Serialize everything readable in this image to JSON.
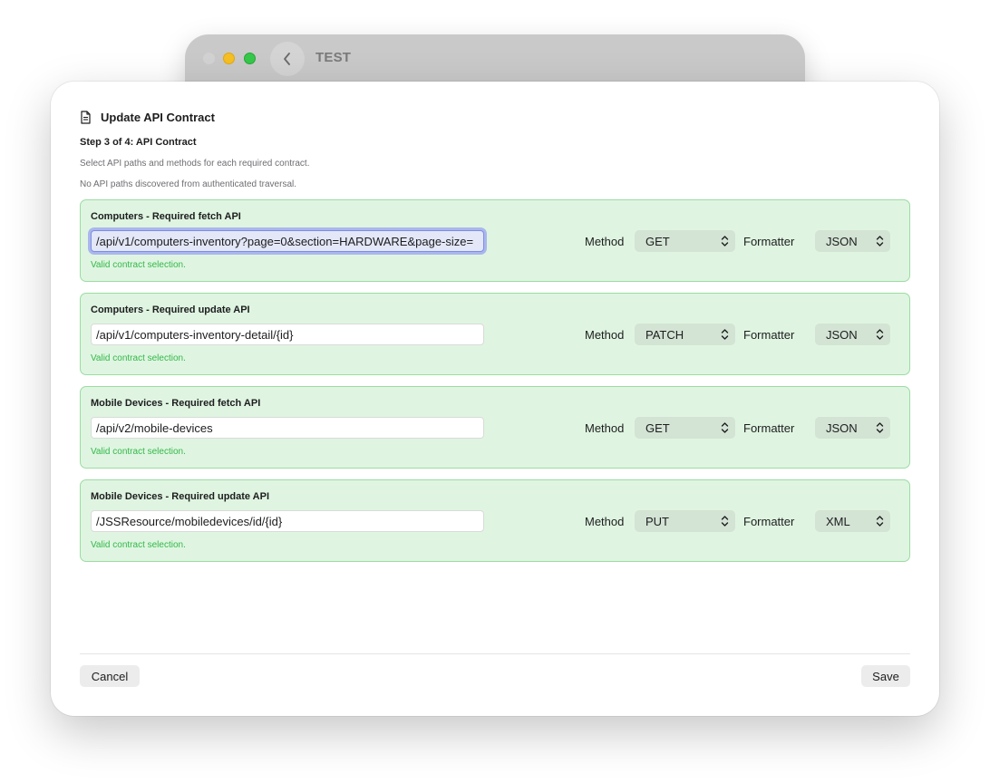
{
  "background_window": {
    "title": "TEST"
  },
  "sheet": {
    "title": "Update API Contract",
    "step": "Step 3 of 4: API Contract",
    "hint": "Select API paths and methods for each required contract.",
    "notice": "No API paths discovered from authenticated traversal."
  },
  "labels": {
    "method": "Method",
    "formatter": "Formatter"
  },
  "contracts": [
    {
      "title": "Computers - Required fetch API",
      "path": "/api/v1/computers-inventory?page=0&section=HARDWARE&page-size=",
      "method": "GET",
      "formatter": "JSON",
      "status": "Valid contract selection."
    },
    {
      "title": "Computers - Required update API",
      "path": "/api/v1/computers-inventory-detail/{id}",
      "method": "PATCH",
      "formatter": "JSON",
      "status": "Valid contract selection."
    },
    {
      "title": "Mobile Devices - Required fetch API",
      "path": "/api/v2/mobile-devices",
      "method": "GET",
      "formatter": "JSON",
      "status": "Valid contract selection."
    },
    {
      "title": "Mobile Devices - Required update API",
      "path": "/JSSResource/mobiledevices/id/{id}",
      "method": "PUT",
      "formatter": "XML",
      "status": "Valid contract selection."
    }
  ],
  "footer": {
    "cancel": "Cancel",
    "save": "Save"
  },
  "colors": {
    "card_background": "#dff5e1",
    "card_border": "#9bdca3",
    "valid_text": "#34b84a",
    "focus_ring": "#aab6ee"
  }
}
